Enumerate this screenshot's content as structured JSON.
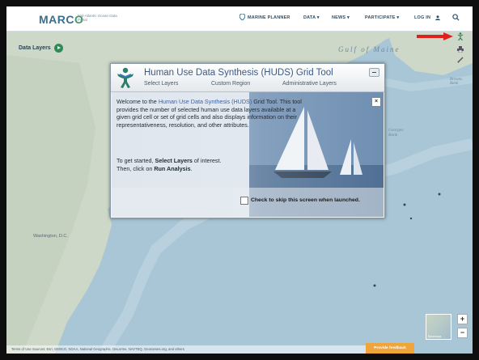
{
  "header": {
    "logo_text": "MARC",
    "logo_o": "O",
    "tagline": "Mid-Atlantic Ocean Data Portal",
    "nav": [
      {
        "label": "MARINE PLANNER"
      },
      {
        "label": "DATA ▾"
      },
      {
        "label": "NEWS ▾"
      },
      {
        "label": "PARTICIPATE ▾"
      },
      {
        "label": "LOG IN"
      }
    ]
  },
  "sidebar": {
    "data_layers_label": "Data Layers"
  },
  "map_labels": {
    "gulf_of_maine": "Gulf of Maine",
    "browns_bank": "Browns Bank",
    "georges_bank": "Georges Bank",
    "washington": "Washington, D.C."
  },
  "dialog": {
    "title": "Human Use Data Synthesis (HUDS) Grid Tool",
    "tabs": [
      "Select Layers",
      "Custom Region",
      "Administrative Layers"
    ],
    "welcome_pre": "Welcome to the ",
    "welcome_hl": "Human Use Data Synthesis (HUDS)",
    "welcome_post": " Grid Tool.  This tool provides the number of selected human use data layers available at a given grid cell or set of grid cells and also displays information on their representativeness, resolution, and other attributes.",
    "instr_pre": "To get started, ",
    "instr_b1": "Select Layers",
    "instr_mid": " of interest.",
    "instr_line2_pre": "Then, click on ",
    "instr_b2": "Run Analysis",
    "instr_line2_post": ".",
    "skip_label": "Check to skip this screen when launched.",
    "close_label": "×"
  },
  "footer": {
    "attribution": "Terms of Use  Sources: Esri, GEBCO, NOAA, National Geographic, DeLorme, NAVTEQ, Geonames.org, and others",
    "feedback_button": "Provide feedback",
    "basemap_label": "Basemaps"
  },
  "zoom": {
    "in": "+",
    "out": "−"
  },
  "colors": {
    "accent": "#3f9a6a",
    "arrow": "#e0201c",
    "feedback": "#f0a53b"
  }
}
